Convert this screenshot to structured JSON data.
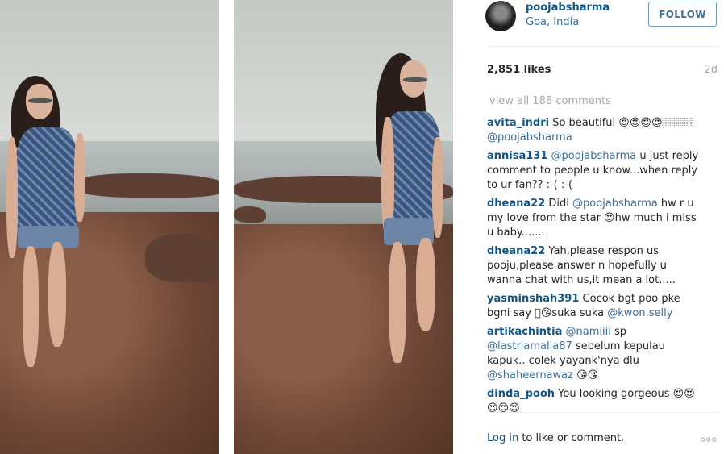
{
  "post": {
    "username": "poojabsharma",
    "location": "Goa, India",
    "follow_label": "FOLLOW",
    "likes": "2,851 likes",
    "age": "2d",
    "view_all": "view all 188 comments"
  },
  "comments": [
    {
      "user": "avita_indri",
      "parts": [
        {
          "t": "So beautiful 😍😍😍😍🏽🏽🏽 "
        },
        {
          "m": "@poojabsharma"
        }
      ]
    },
    {
      "user": "annisa131",
      "parts": [
        {
          "m": "@poojabsharma"
        },
        {
          "t": " u just reply comment to people u know...when reply to ur fan?? :-( :-("
        }
      ]
    },
    {
      "user": "dheana22",
      "parts": [
        {
          "t": "Didi "
        },
        {
          "m": "@poojabsharma"
        },
        {
          "t": " hw r u my love from the star 😍hw much i miss u baby......."
        }
      ]
    },
    {
      "user": "dheana22",
      "parts": [
        {
          "t": "Yah,please respon us pooju,please answer n hopefully u wanna chat with us,it mean a lot....."
        }
      ]
    },
    {
      "user": "yasminshah391",
      "parts": [
        {
          "t": "Cocok bgt poo pke bgni say 🏽😘suka suka "
        },
        {
          "m": "@kwon.selly"
        }
      ]
    },
    {
      "user": "artikachintia",
      "parts": [
        {
          "m": "@namiiii"
        },
        {
          "t": "  sp "
        },
        {
          "m": "@lastriamalia87"
        },
        {
          "t": " sebelum kepulau kapuk.. colek yayank'nya dlu "
        },
        {
          "m": "@shaheernawaz"
        },
        {
          "t": " 😘😘"
        }
      ]
    },
    {
      "user": "dinda_pooh",
      "parts": [
        {
          "t": "You looking gorgeous 😍😍😍😍😍"
        }
      ]
    }
  ],
  "footer": {
    "login_link": "Log in",
    "login_rest": " to like or comment.",
    "more": "ooo"
  },
  "colors": {
    "link": "#125688",
    "mention": "#3d6d99",
    "muted": "#a5a7aa"
  }
}
